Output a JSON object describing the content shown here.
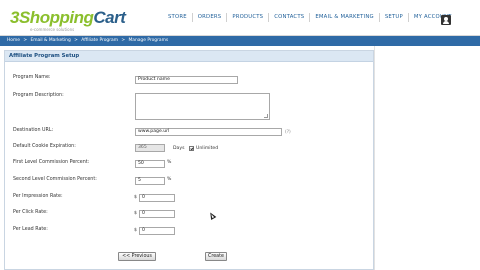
{
  "header": {
    "logo_part1": "Shopping",
    "logo_part2": "Cart",
    "logo_prefix": "3",
    "tagline": "e-commerce solutions",
    "nav": [
      "STORE",
      "ORDERS",
      "PRODUCTS",
      "CONTACTS",
      "EMAIL & MARKETING",
      "SETUP",
      "MY ACCOUNT"
    ]
  },
  "breadcrumb": [
    "Home",
    ">",
    "Email & Marketing",
    ">",
    "Affiliate Program",
    ">",
    "Manage Programs"
  ],
  "panel": {
    "title": "Affiliate Program Setup"
  },
  "form": {
    "program_name": {
      "label": "Program Name:",
      "value": "Product name"
    },
    "program_description": {
      "label": "Program Description:",
      "value": ""
    },
    "destination_url": {
      "label": "Destination URL:",
      "value": "www.page.url",
      "suffix": "(?)"
    },
    "cookie_expiration": {
      "label": "Default Cookie Expiration:",
      "value": "365",
      "unit": "Days",
      "checkbox_label": "Unlimited",
      "checked": true
    },
    "first_level_commission": {
      "label": "First Level Commission Percent:",
      "value": "50",
      "unit": "%"
    },
    "second_level_commission": {
      "label": "Second Level Commission Percent:",
      "value": "5",
      "unit": "%"
    },
    "per_impression_rate": {
      "label": "Per Impression Rate:",
      "currency": "$",
      "value": "0"
    },
    "per_click_rate": {
      "label": "Per Click Rate:",
      "currency": "$",
      "value": "0"
    },
    "per_lead_rate": {
      "label": "Per Lead Rate:",
      "currency": "$",
      "value": "0"
    }
  },
  "buttons": {
    "previous": "<< Previous",
    "create": "Create"
  }
}
